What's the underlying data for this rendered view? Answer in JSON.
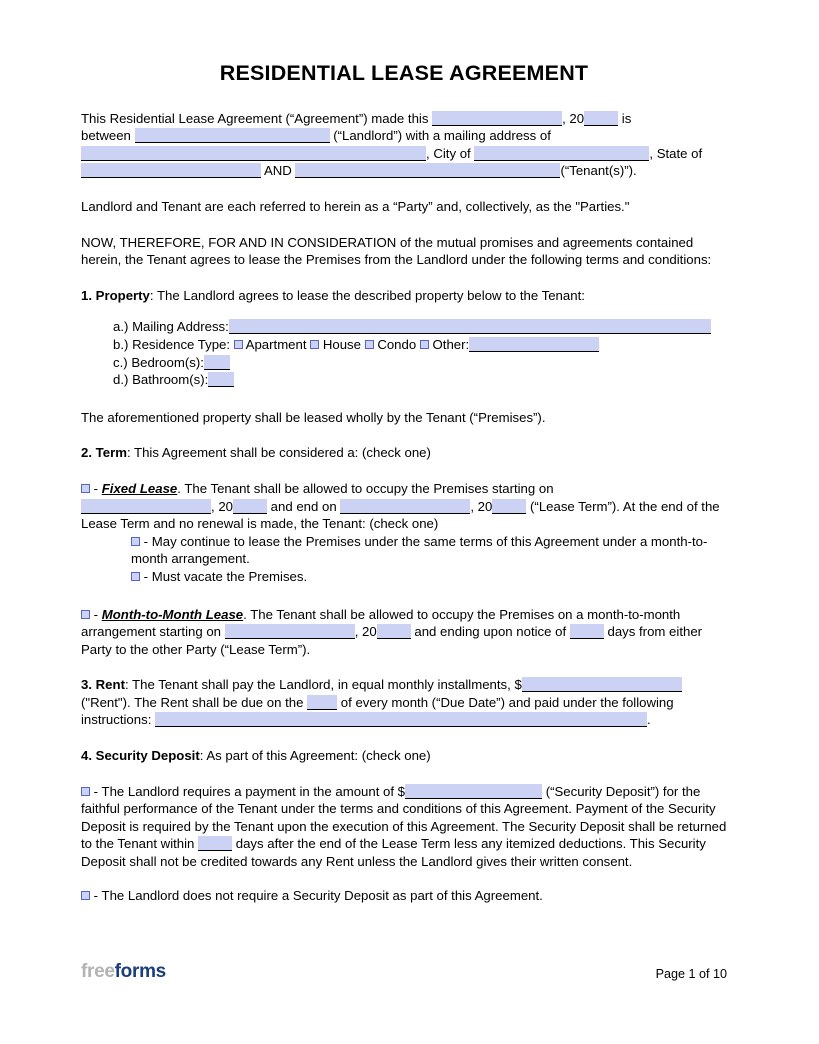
{
  "document": {
    "title": "RESIDENTIAL LEASE AGREEMENT"
  },
  "intro": {
    "line1_a": "This Residential Lease Agreement (“Agreement”) made this",
    "line1_b": ", 20",
    "line1_c": "is",
    "line2_a": "between",
    "line2_b": "(“Landlord”) with a mailing address of",
    "line3_b": ", City of",
    "line3_c": ", State of",
    "line4_b": "AND",
    "line4_c": "(“Tenant(s)”)."
  },
  "parties_para": "Landlord and Tenant are each referred to herein as a “Party” and, collectively, as the \"Parties.\"",
  "consideration_para": "NOW, THEREFORE, FOR AND IN CONSIDERATION of the mutual promises and agreements contained herein, the Tenant agrees to lease the Premises from the Landlord under the following terms and conditions:",
  "section_property": {
    "number": "1. Property",
    "heading_rest": ": The Landlord agrees to lease the described property below to the Tenant:",
    "items": [
      {
        "marker": "a.)",
        "label": "Mailing Address:"
      },
      {
        "marker": "b.)",
        "label": "Residence Type:"
      },
      {
        "marker": "c.)",
        "label": "Bedroom(s):"
      },
      {
        "marker": "d.)",
        "label": "Bathroom(s):"
      }
    ],
    "residence_types": [
      {
        "label": "Apartment"
      },
      {
        "label": "House"
      },
      {
        "label": "Condo"
      },
      {
        "label": "Other:"
      }
    ],
    "premises_para": "The aforementioned property shall be leased wholly by the Tenant (“Premises”)."
  },
  "section_term": {
    "number": "2. Term",
    "heading_rest": ": This Agreement shall be considered a: (check one)",
    "fixed": {
      "dash": "-",
      "name": "Fixed Lease",
      "text_a": ". The Tenant shall be allowed to occupy the Premises starting on",
      "text_b": ", 20",
      "text_c": "and end on",
      "text_d": ", 20",
      "text_e": "(“Lease Term”). At the end of the Lease Term and no renewal is made, the Tenant: (check one)",
      "options": [
        {
          "dash": "-",
          "label": "May continue to lease the Premises under the same terms of this Agreement under a month-to-month arrangement."
        },
        {
          "dash": "-",
          "label": "Must vacate the Premises."
        }
      ]
    },
    "mtm": {
      "dash": "-",
      "name": "Month-to-Month Lease",
      "text_a": ". The Tenant shall be allowed to occupy the Premises on a month-to-month arrangement starting on",
      "text_b": ", 20",
      "text_c": "and ending upon notice of",
      "text_d": "days from either Party to the other Party (“Lease Term”)."
    }
  },
  "section_rent": {
    "number": "3. Rent",
    "text_a": ": The Tenant shall pay the Landlord, in equal monthly installments, $",
    "text_b": "(\"Rent\"). The Rent shall be due on the",
    "text_c": "of every month (“Due Date”) and paid under the following instructions:",
    "text_d": "."
  },
  "section_deposit": {
    "number": "4. Security Deposit",
    "heading_rest": ": As part of this Agreement: (check one)",
    "option1": {
      "dash": "-",
      "text_a": "The Landlord requires a payment in the amount of $",
      "text_b": "(“Security Deposit”) for the faithful performance of the Tenant under the terms and conditions of this Agreement. Payment of the Security Deposit is required by the Tenant upon the execution of this Agreement. The Security Deposit shall be returned to the Tenant within",
      "text_c": "days after the end of the Lease Term less any itemized deductions. This Security Deposit shall not be credited towards any Rent unless the Landlord gives their written consent."
    },
    "option2": {
      "dash": "-",
      "text": "The Landlord does not require a Security Deposit as part of this Agreement."
    }
  },
  "footer": {
    "logo_free": "free",
    "logo_forms": "forms",
    "page_label": "Page 1 of 10"
  },
  "colors": {
    "blank_fill": "#ccd2f3",
    "checkbox_border": "#5566c4",
    "logo_gray": "#b3b3b3",
    "logo_blue": "#1b3c7d"
  }
}
